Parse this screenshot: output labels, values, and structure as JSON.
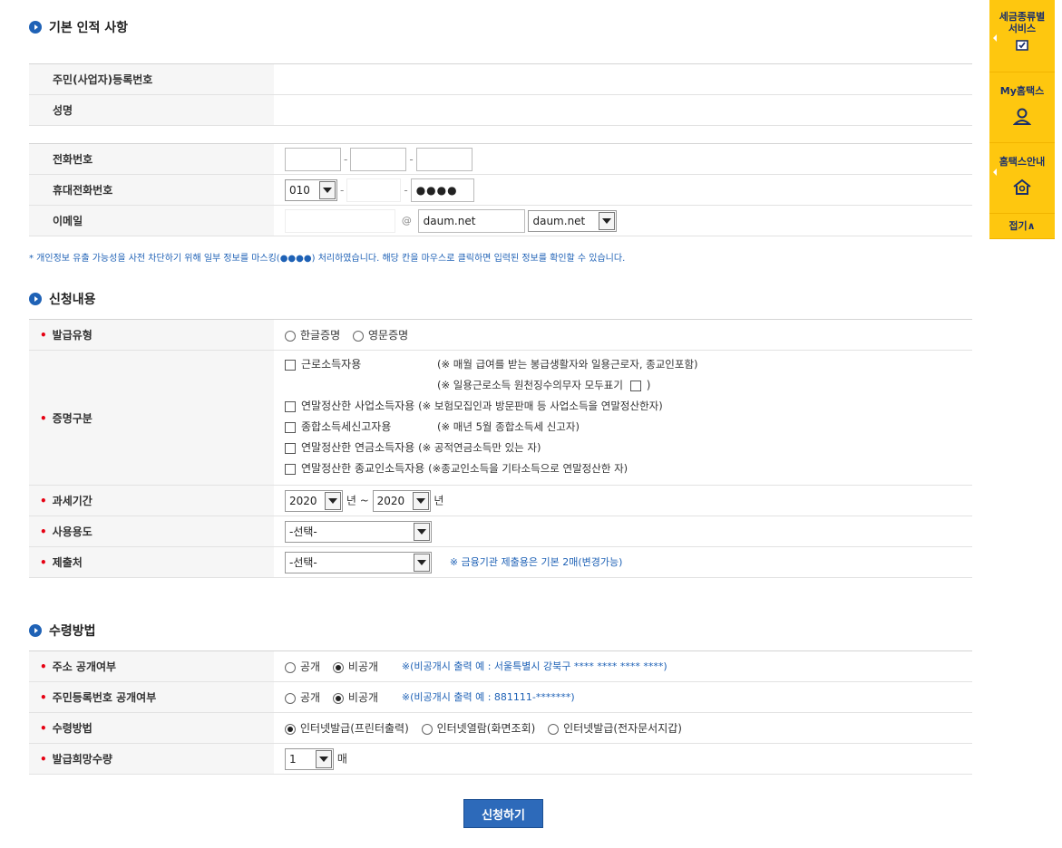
{
  "sections": {
    "basic": "기본 인적 사항",
    "apply": "신청내용",
    "receive": "수령방법"
  },
  "basic": {
    "rrn_label": "주민(사업자)등록번호",
    "name_label": "성명",
    "phone_label": "전화번호",
    "mobile_label": "휴대전화번호",
    "mobile_prefix": "010",
    "mobile_masked": "●●●●",
    "email_label": "이메일",
    "email_at": "@",
    "email_domain": "daum.net",
    "email_domain_select": "daum.net"
  },
  "notice": "* 개인정보 유출 가능성을 사전 차단하기 위해 일부 정보를 마스킹(●●●●) 처리하였습니다. 해당 칸을 마우스로 클릭하면 입력된 정보를 확인할 수 있습니다.",
  "apply": {
    "issue_type_label": "발급유형",
    "issue_korean": "한글증명",
    "issue_english": "영문증명",
    "cert_label": "증명구분",
    "cert_options": [
      {
        "label": "근로소득자용",
        "desc": "(※ 매월 급여를 받는 봉급생활자와 일용근로자, 종교인포함)"
      },
      {
        "label": "연말정산한 사업소득자용",
        "desc": "(※ 보험모집인과 방문판매 등 사업소득을 연말정산한자)"
      },
      {
        "label": "종합소득세신고자용",
        "desc": "(※ 매년 5월 종합소득세 신고자)"
      },
      {
        "label": "연말정산한 연금소득자용",
        "desc": "(※ 공적연금소득만 있는 자)"
      },
      {
        "label": "연말정산한 종교인소득자용",
        "desc": "(※종교인소득을 기타소득으로 연말정산한 자)"
      }
    ],
    "daily_worker_note": "(※ 일용근로소득 원천징수의무자 모두표기",
    "daily_worker_close": ")",
    "period_label": "과세기간",
    "period_from": "2020",
    "period_to": "2020",
    "year_unit": "년",
    "tilde": "~",
    "usage_label": "사용용도",
    "usage_value": "-선택-",
    "submit_to_label": "제출처",
    "submit_to_value": "-선택-",
    "submit_to_note": "※ 금융기관 제출용은 기본 2매(변경가능)"
  },
  "receive": {
    "address_label": "주소 공개여부",
    "public": "공개",
    "private": "비공개",
    "address_note": "※(비공개시 출력 예 : 서울특별시 강북구 **** **** **** ****)",
    "rrn_public_label": "주민등록번호 공개여부",
    "rrn_note": "※(비공개시 출력 예 : 881111-*******)",
    "method_label": "수령방법",
    "method_print": "인터넷발급(프린터출력)",
    "method_view": "인터넷열람(화면조회)",
    "method_wallet": "인터넷발급(전자문서지갑)",
    "qty_label": "발급희망수량",
    "qty_value": "1",
    "qty_unit": "매"
  },
  "submit_label": "신청하기",
  "quick_menu": {
    "item1": "세금종류별 서비스",
    "item2": "My홈택스",
    "item3": "홈택스안내",
    "fold": "접기∧"
  },
  "colors": {
    "accent": "#1f62b6",
    "required": "#e60012",
    "quick_bg": "#fec70f",
    "button": "#2d6aba"
  },
  "icons": [
    "section-bullet-icon",
    "checkbox-icon",
    "person-icon",
    "home-icon",
    "chevron-down-icon"
  ]
}
